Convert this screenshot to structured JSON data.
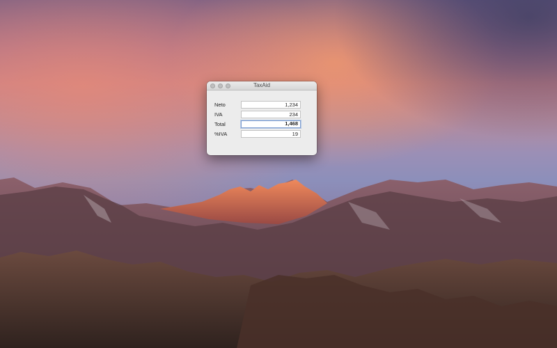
{
  "window": {
    "title": "TaxAid"
  },
  "form": {
    "rows": [
      {
        "label": "Neto",
        "value": "1,234"
      },
      {
        "label": "IVA",
        "value": "234"
      },
      {
        "label": "Total",
        "value": "1,468"
      },
      {
        "label": "%IVA",
        "value": "19"
      }
    ]
  },
  "colors": {
    "window_background": "#ececec",
    "focus_ring": "#7e9ed0",
    "traffic_light_inactive": "#bfbfbf"
  },
  "icons": {
    "close": "close-icon",
    "minimize": "minimize-icon",
    "zoom": "zoom-icon"
  }
}
